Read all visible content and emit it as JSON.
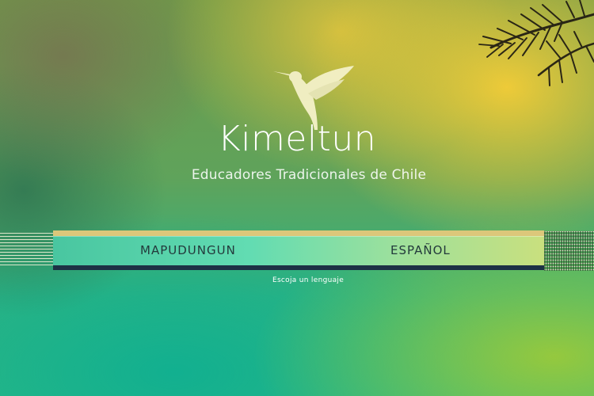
{
  "brand": {
    "name": "Kimeltun",
    "subtitle": "Educadores Tradicionales de Chile",
    "logo_icon": "hummingbird-icon"
  },
  "language_selector": {
    "options": [
      {
        "label": "MAPUDUNGUN"
      },
      {
        "label": "ESPAÑOL"
      }
    ],
    "hint": "Escoja un lenguaje"
  },
  "colors": {
    "accent_gold": "#dcc77a",
    "bar_dark": "#1d3145",
    "bar_gradient_start": "#49c6a0",
    "bar_gradient_end": "#c9e07e",
    "text_dark": "#233a3c"
  }
}
